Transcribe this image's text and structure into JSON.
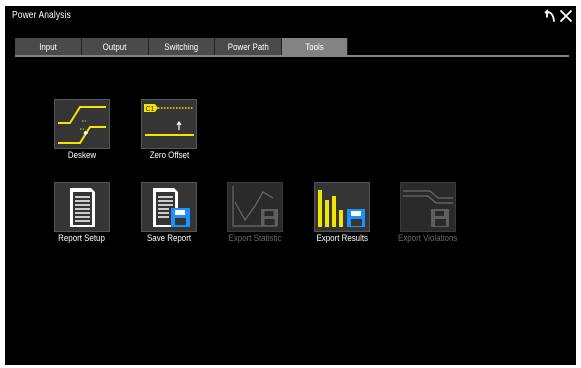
{
  "window": {
    "title": "Power Analysis"
  },
  "titlebar": {
    "undo_icon": "undo-arrow-icon",
    "close_icon": "close-icon"
  },
  "tabs": [
    {
      "label": "Input",
      "active": false
    },
    {
      "label": "Output",
      "active": false
    },
    {
      "label": "Switching",
      "active": false
    },
    {
      "label": "Power Path",
      "active": false
    },
    {
      "label": "Tools",
      "active": true
    }
  ],
  "tools": {
    "deskew": {
      "label": "Deskew",
      "enabled": true,
      "icon": "deskew-icon"
    },
    "zero_offset": {
      "label": "Zero Offset",
      "enabled": true,
      "icon": "zero-offset-icon",
      "badge": "C1"
    },
    "report_setup": {
      "label": "Report Setup",
      "enabled": true,
      "icon": "report-document-icon"
    },
    "save_report": {
      "label": "Save Report",
      "enabled": true,
      "icon": "save-report-icon"
    },
    "export_statistic": {
      "label": "Export Statistic",
      "enabled": false,
      "icon": "export-statistic-icon"
    },
    "export_results": {
      "label": "Export Results",
      "enabled": true,
      "icon": "export-results-icon"
    },
    "export_violations": {
      "label": "Export Violations",
      "enabled": false,
      "icon": "export-violations-icon"
    }
  },
  "colors": {
    "background": "#000000",
    "tab": "#4a4a4a",
    "tab_active": "#838383",
    "tile": "#555555",
    "accent_yellow": "#f2e600",
    "accent_blue": "#1e90ff",
    "disabled_text": "#6a6a6a"
  }
}
